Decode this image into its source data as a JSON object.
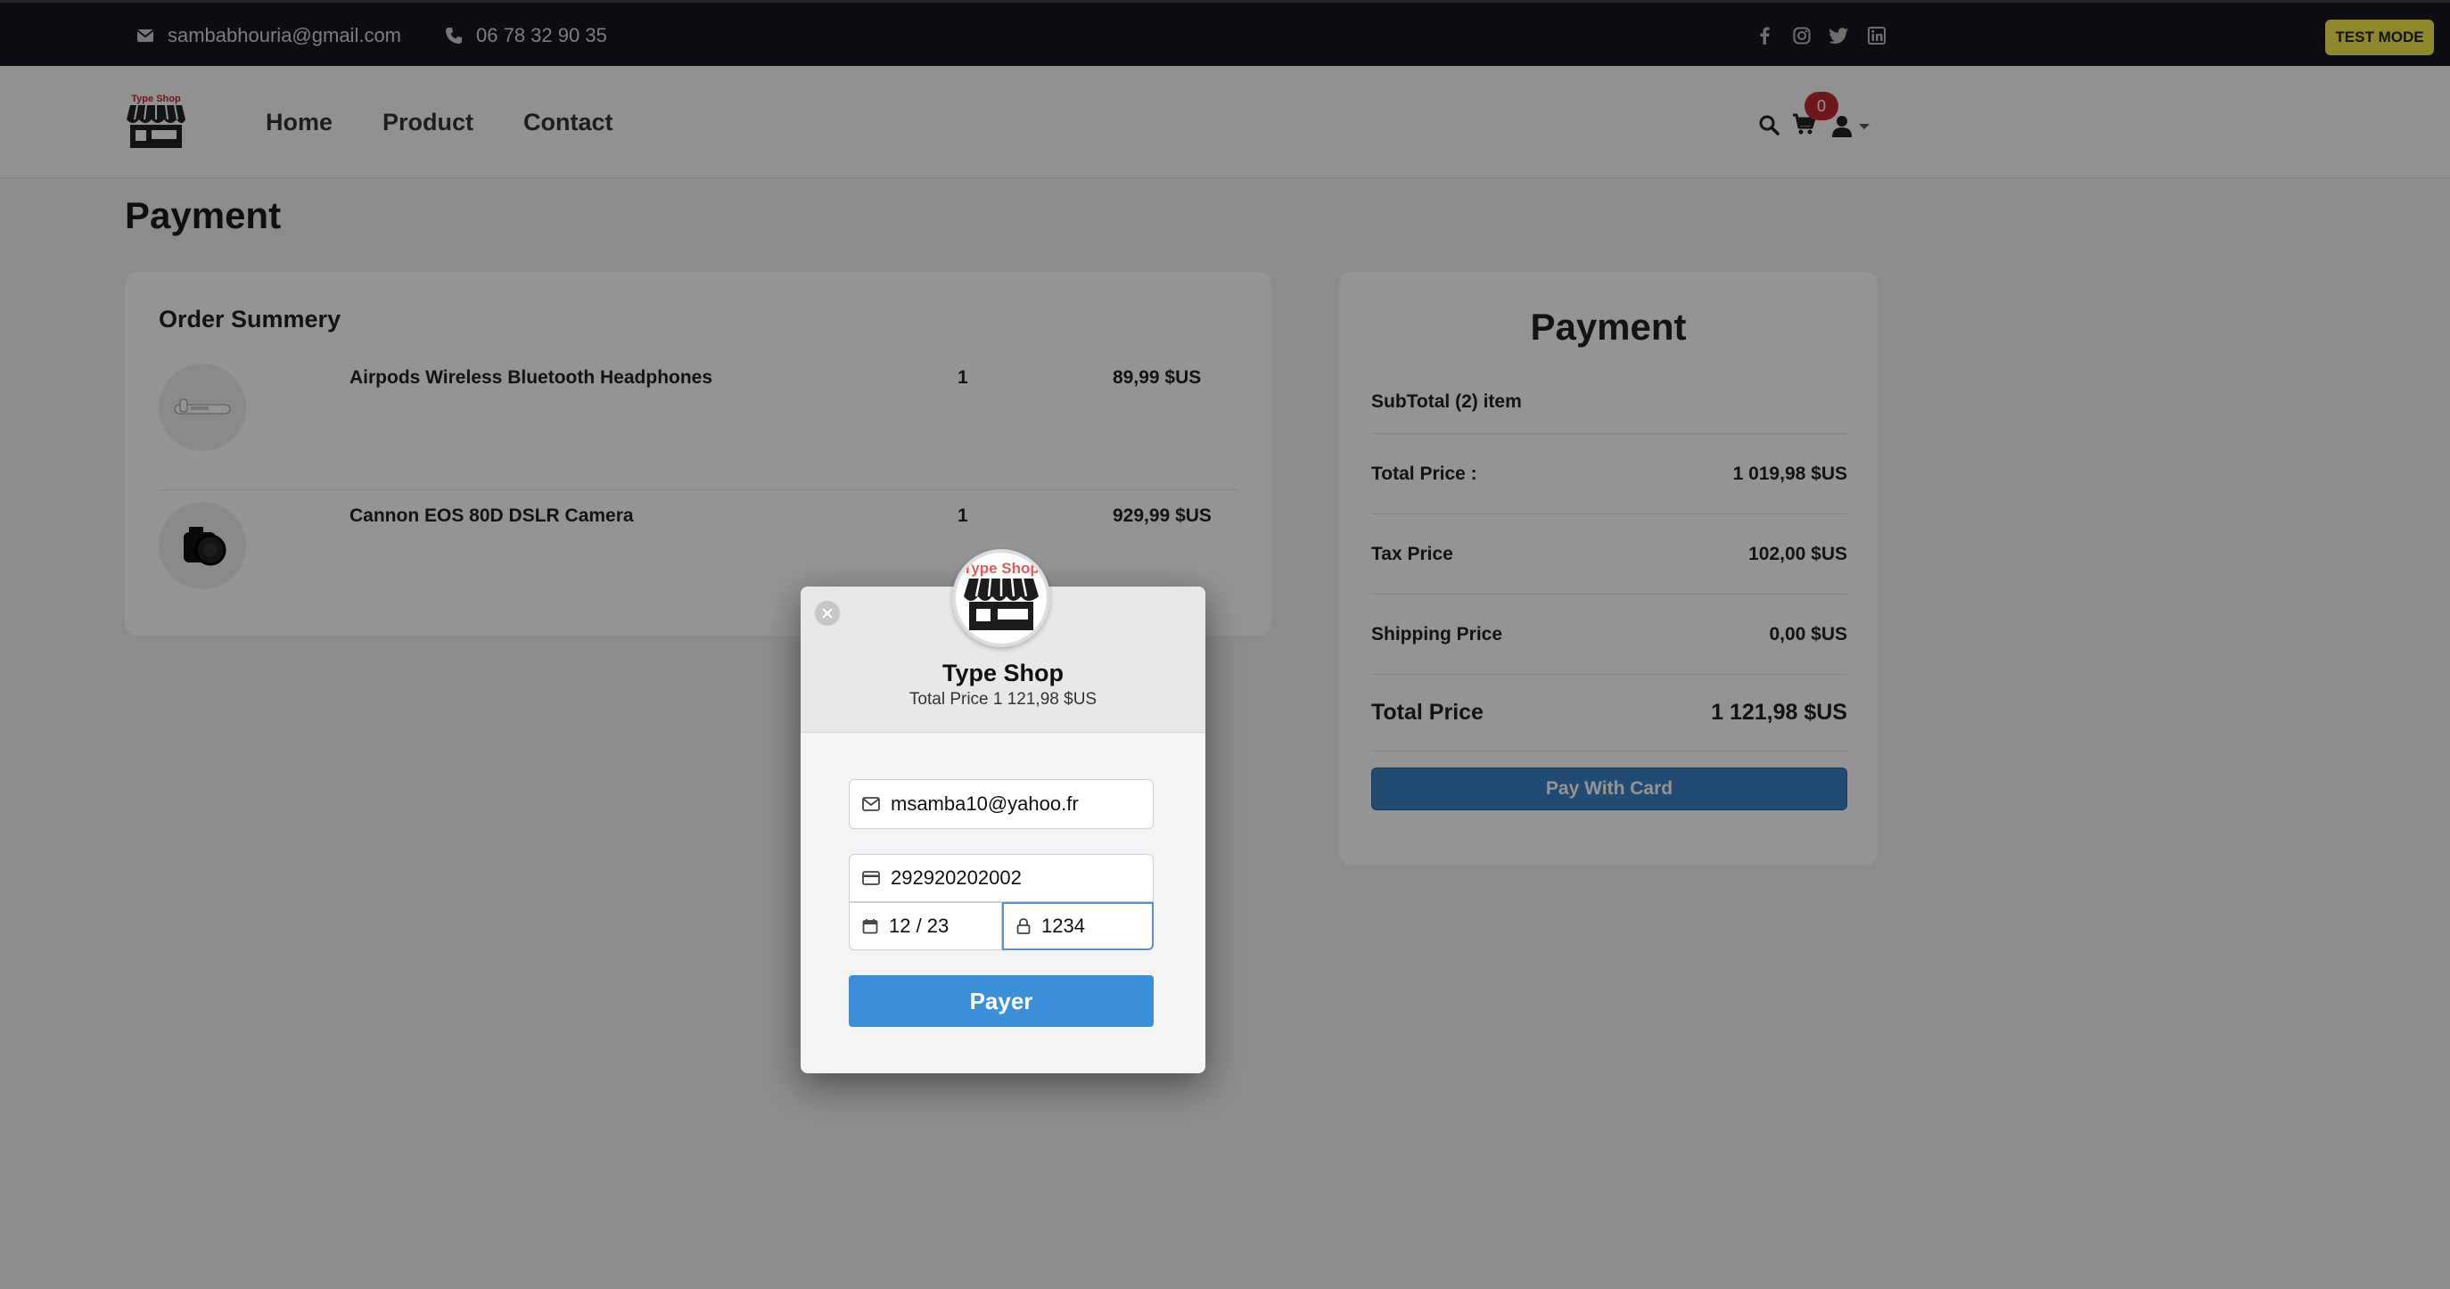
{
  "topbar": {
    "email": "sambabhouria@gmail.com",
    "phone": "06 78 32 90 35",
    "social_icons": [
      "facebook-icon",
      "instagram-icon",
      "twitter-icon",
      "linkedin-icon"
    ],
    "test_mode": "TEST MODE"
  },
  "nav": {
    "logo_text": "Type Shop",
    "links": [
      "Home",
      "Product",
      "Contact"
    ],
    "cart_count": "0"
  },
  "page": {
    "title": "Payment"
  },
  "order_summary": {
    "heading": "Order Summery",
    "items": [
      {
        "name": "Airpods Wireless Bluetooth Headphones",
        "qty": "1",
        "price": "89,99 $US"
      },
      {
        "name": "Cannon EOS 80D DSLR Camera",
        "qty": "1",
        "price": "929,99 $US"
      }
    ]
  },
  "payment_card": {
    "heading": "Payment",
    "subtotal": "SubTotal (2) item",
    "rows": [
      {
        "label": "Total Price :",
        "value": "1 019,98 $US"
      },
      {
        "label": "Tax Price",
        "value": "102,00 $US"
      },
      {
        "label": "Shipping Price",
        "value": "0,00 $US"
      },
      {
        "label": "Total Price",
        "value": "1 121,98 $US"
      }
    ],
    "button": "Pay With Card"
  },
  "modal": {
    "logo_text": "Type Shop",
    "name": "Type Shop",
    "total": "Total Price 1 121,98 $US",
    "email": "msamba10@yahoo.fr",
    "card_number": "292920202002",
    "expiry": "12 / 23",
    "cvc": "1234",
    "pay_button": "Payer"
  },
  "colors": {
    "topbar_bg": "#14171f",
    "test_mode_bg": "#f6e94a",
    "badge": "#c0272d",
    "pay_blue": "#3a8fd8"
  }
}
